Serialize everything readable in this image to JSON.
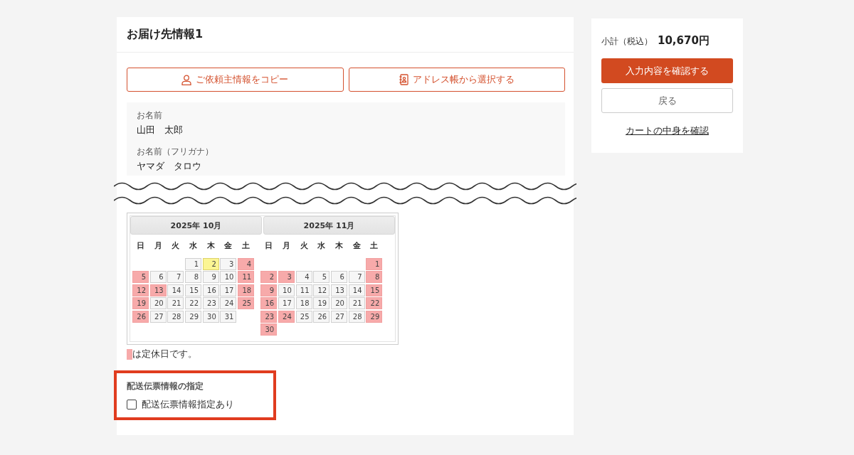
{
  "delivery": {
    "title": "お届け先情報1",
    "buttons": [
      {
        "label": "ご依頼主情報をコピー"
      },
      {
        "label": "アドレス帳から選択する"
      }
    ],
    "fields": [
      {
        "label": "お名前",
        "value": "山田　太郎"
      },
      {
        "label": "お名前（フリガナ）",
        "value": "ヤマダ　タロウ"
      }
    ],
    "calendar": {
      "months": [
        {
          "title": "2025年 10月",
          "weekdays": [
            "日",
            "月",
            "火",
            "水",
            "木",
            "金",
            "土"
          ],
          "weeks": [
            [
              {
                "kind": "blank"
              },
              {
                "kind": "blank"
              },
              {
                "kind": "blank"
              },
              {
                "day": "1",
                "kind": "open"
              },
              {
                "day": "2",
                "kind": "today"
              },
              {
                "day": "3",
                "kind": "open"
              },
              {
                "day": "4",
                "kind": "holiday"
              }
            ],
            [
              {
                "day": "5",
                "kind": "holiday"
              },
              {
                "day": "6",
                "kind": "open"
              },
              {
                "day": "7",
                "kind": "open"
              },
              {
                "day": "8",
                "kind": "open"
              },
              {
                "day": "9",
                "kind": "open"
              },
              {
                "day": "10",
                "kind": "open"
              },
              {
                "day": "11",
                "kind": "holiday"
              }
            ],
            [
              {
                "day": "12",
                "kind": "holiday"
              },
              {
                "day": "13",
                "kind": "holiday"
              },
              {
                "day": "14",
                "kind": "open"
              },
              {
                "day": "15",
                "kind": "open"
              },
              {
                "day": "16",
                "kind": "open"
              },
              {
                "day": "17",
                "kind": "open"
              },
              {
                "day": "18",
                "kind": "holiday"
              }
            ],
            [
              {
                "day": "19",
                "kind": "holiday"
              },
              {
                "day": "20",
                "kind": "open"
              },
              {
                "day": "21",
                "kind": "open"
              },
              {
                "day": "22",
                "kind": "open"
              },
              {
                "day": "23",
                "kind": "open"
              },
              {
                "day": "24",
                "kind": "open"
              },
              {
                "day": "25",
                "kind": "holiday"
              }
            ],
            [
              {
                "day": "26",
                "kind": "holiday"
              },
              {
                "day": "27",
                "kind": "open"
              },
              {
                "day": "28",
                "kind": "open"
              },
              {
                "day": "29",
                "kind": "open"
              },
              {
                "day": "30",
                "kind": "open"
              },
              {
                "day": "31",
                "kind": "open"
              },
              {
                "kind": "blank"
              }
            ]
          ]
        },
        {
          "title": "2025年 11月",
          "weekdays": [
            "日",
            "月",
            "火",
            "水",
            "木",
            "金",
            "土"
          ],
          "weeks": [
            [
              {
                "kind": "blank"
              },
              {
                "kind": "blank"
              },
              {
                "kind": "blank"
              },
              {
                "kind": "blank"
              },
              {
                "kind": "blank"
              },
              {
                "kind": "blank"
              },
              {
                "day": "1",
                "kind": "holiday"
              }
            ],
            [
              {
                "day": "2",
                "kind": "holiday"
              },
              {
                "day": "3",
                "kind": "holiday"
              },
              {
                "day": "4",
                "kind": "open"
              },
              {
                "day": "5",
                "kind": "open"
              },
              {
                "day": "6",
                "kind": "open"
              },
              {
                "day": "7",
                "kind": "open"
              },
              {
                "day": "8",
                "kind": "holiday"
              }
            ],
            [
              {
                "day": "9",
                "kind": "holiday"
              },
              {
                "day": "10",
                "kind": "open"
              },
              {
                "day": "11",
                "kind": "open"
              },
              {
                "day": "12",
                "kind": "open"
              },
              {
                "day": "13",
                "kind": "open"
              },
              {
                "day": "14",
                "kind": "open"
              },
              {
                "day": "15",
                "kind": "holiday"
              }
            ],
            [
              {
                "day": "16",
                "kind": "holiday"
              },
              {
                "day": "17",
                "kind": "open"
              },
              {
                "day": "18",
                "kind": "open"
              },
              {
                "day": "19",
                "kind": "open"
              },
              {
                "day": "20",
                "kind": "open"
              },
              {
                "day": "21",
                "kind": "open"
              },
              {
                "day": "22",
                "kind": "holiday"
              }
            ],
            [
              {
                "day": "23",
                "kind": "holiday"
              },
              {
                "day": "24",
                "kind": "holiday"
              },
              {
                "day": "25",
                "kind": "open"
              },
              {
                "day": "26",
                "kind": "open"
              },
              {
                "day": "27",
                "kind": "open"
              },
              {
                "day": "28",
                "kind": "open"
              },
              {
                "day": "29",
                "kind": "holiday"
              }
            ],
            [
              {
                "day": "30",
                "kind": "holiday"
              },
              {
                "kind": "blank"
              },
              {
                "kind": "blank"
              },
              {
                "kind": "blank"
              },
              {
                "kind": "blank"
              },
              {
                "kind": "blank"
              },
              {
                "kind": "blank"
              }
            ]
          ]
        }
      ]
    },
    "legend": "は定休日です。",
    "slip": {
      "label": "配送伝票情報の指定",
      "option": "配送伝票情報指定あり",
      "checked": false
    }
  },
  "summary": {
    "label": "小計（税込）",
    "total": "10,670円",
    "confirm_button": "入力内容を確認する",
    "back_button": "戻る",
    "cart_link": "カートの中身を確認"
  }
}
